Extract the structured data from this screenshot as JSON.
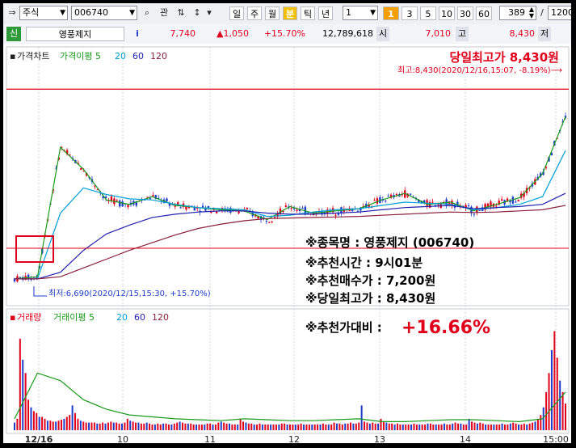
{
  "toolbar": {
    "market_type": "주식",
    "stock_code": "006740",
    "btn_gwan": "관",
    "period_buttons": [
      "일",
      "주",
      "월",
      "분",
      "틱",
      "년"
    ],
    "active_period": "분",
    "interval_value": "1",
    "minute_buttons": [
      "1",
      "3",
      "5",
      "10",
      "30",
      "60"
    ],
    "active_minute": "1",
    "count_value": "389",
    "slash": "/",
    "total_value": "1200"
  },
  "quote": {
    "tag": "신",
    "stock_name": "영풍제지",
    "info_icon": "i",
    "price": "7,740",
    "change": "▲1,050",
    "change_pct": "+15.70%",
    "volume": "12,789,618",
    "open_label": "시",
    "open_value": "7,010",
    "high_label": "고",
    "high_value": "8,430",
    "low_label": "저"
  },
  "price_panel": {
    "legend": [
      {
        "label": "가격차트",
        "color": "#222222"
      },
      {
        "label": "가격이평 5",
        "color": "#1a9a1a"
      },
      {
        "label": "20",
        "color": "#00a0d8"
      },
      {
        "label": "60",
        "color": "#2020b0"
      },
      {
        "label": "120",
        "color": "#8a1f3c"
      }
    ],
    "banner_high": "당일최고가 8,430원",
    "annotation_high": "최고:8,430(2020/12/16,15:07, -8.19%)⟶",
    "annotation_low": "최저:6,690(2020/12/15,15:30, +15.70%)",
    "info_lines": [
      "※종목명 : 영풍제지 (006740)",
      "※추천시간 : 9시01분",
      "※추천매수가 : 7,200원",
      "※당일최고가 : 8,430원"
    ],
    "info_ratio_label": "※추천가대비 : ",
    "info_ratio_value": "+16.66%"
  },
  "volume_panel": {
    "legend": [
      {
        "label": "거래량",
        "color": "#e0001b"
      },
      {
        "label": "거래이평 5",
        "color": "#1a9a1a"
      },
      {
        "label": "20",
        "color": "#00a0d8"
      },
      {
        "label": "60",
        "color": "#2020b0"
      },
      {
        "label": "120",
        "color": "#8a1f3c"
      }
    ]
  },
  "chart_data": {
    "type": "line",
    "title": "",
    "xlabel": "",
    "ylabel": "",
    "x_ticks": [
      "12/16",
      "10",
      "11",
      "12",
      "13",
      "14",
      "15:00"
    ],
    "ylim": [
      6500,
      8550
    ],
    "reference_line": 8430,
    "high": 8430,
    "low": 6690,
    "series": [
      {
        "name": "가격이평 5",
        "values": [
          6700,
          6720,
          7900,
          7700,
          7420,
          7380,
          7450,
          7370,
          7350,
          7330,
          7320,
          7240,
          7360,
          7300,
          7320,
          7340,
          7420,
          7480,
          7380,
          7400,
          7320,
          7380,
          7440,
          7660,
          8180
        ]
      },
      {
        "name": "20",
        "values": [
          6700,
          6700,
          7300,
          7530,
          7470,
          7430,
          7420,
          7380,
          7350,
          7340,
          7330,
          7270,
          7280,
          7310,
          7330,
          7340,
          7370,
          7400,
          7390,
          7380,
          7330,
          7350,
          7380,
          7450,
          7870
        ]
      },
      {
        "name": "60",
        "values": [
          6700,
          6700,
          6760,
          6960,
          7110,
          7190,
          7260,
          7290,
          7310,
          7320,
          7320,
          7300,
          7290,
          7290,
          7300,
          7310,
          7330,
          7350,
          7360,
          7370,
          7340,
          7350,
          7360,
          7380,
          7480
        ]
      },
      {
        "name": "120",
        "values": [
          6700,
          6700,
          6720,
          6800,
          6880,
          6960,
          7030,
          7100,
          7160,
          7200,
          7230,
          7250,
          7255,
          7260,
          7265,
          7270,
          7280,
          7290,
          7300,
          7310,
          7305,
          7310,
          7320,
          7330,
          7370
        ]
      }
    ],
    "volume_series": [
      {
        "name": "거래량",
        "values": [
          40,
          60,
          480,
          370,
          300,
          160,
          120,
          100,
          90,
          70,
          70,
          60,
          50,
          50,
          45,
          45,
          50,
          55,
          60,
          70,
          80,
          130,
          90,
          60,
          50,
          45,
          40,
          40,
          40,
          40,
          35,
          35,
          40,
          35,
          40,
          45,
          40,
          40,
          35,
          35,
          40,
          60,
          50,
          45,
          40,
          40,
          35,
          35,
          40,
          35,
          30,
          30,
          35,
          30,
          35,
          35,
          30,
          30,
          35,
          40,
          45,
          40,
          35,
          35,
          35,
          30,
          30,
          30,
          30,
          30,
          35,
          35,
          30,
          30,
          40,
          45,
          40,
          35,
          35,
          30,
          30,
          30,
          60,
          45,
          40,
          35,
          35,
          30,
          30,
          35,
          30,
          30,
          30,
          30,
          30,
          30,
          30,
          35,
          35,
          30,
          30,
          30,
          30,
          30,
          35,
          30,
          30,
          30,
          30,
          30,
          30,
          30,
          35,
          30,
          30,
          30,
          40,
          35,
          35,
          30,
          35,
          35,
          40,
          35,
          35,
          40,
          130,
          45,
          40,
          35,
          40,
          35,
          35,
          60,
          45,
          40,
          35,
          35,
          30,
          35,
          30,
          30,
          30,
          30,
          30,
          35,
          30,
          30,
          30,
          30,
          35,
          35,
          30,
          30,
          30,
          30,
          35,
          30,
          30,
          35,
          40,
          35,
          35,
          30,
          30,
          60,
          45,
          40,
          35,
          40,
          35,
          30,
          30,
          30,
          30,
          30,
          30,
          35,
          30,
          30,
          35,
          40,
          35,
          30,
          30,
          35,
          30,
          35,
          40,
          45,
          60,
          80,
          120,
          200,
          300,
          420,
          520,
          380,
          260,
          200,
          140
        ]
      },
      {
        "name": "거래이평 5",
        "values": [
          60,
          300,
          260,
          160,
          110,
          80,
          70,
          60,
          55,
          50,
          60,
          55,
          50,
          50,
          55,
          60,
          45,
          45,
          50,
          55,
          55,
          50,
          45,
          60,
          200
        ]
      }
    ]
  }
}
